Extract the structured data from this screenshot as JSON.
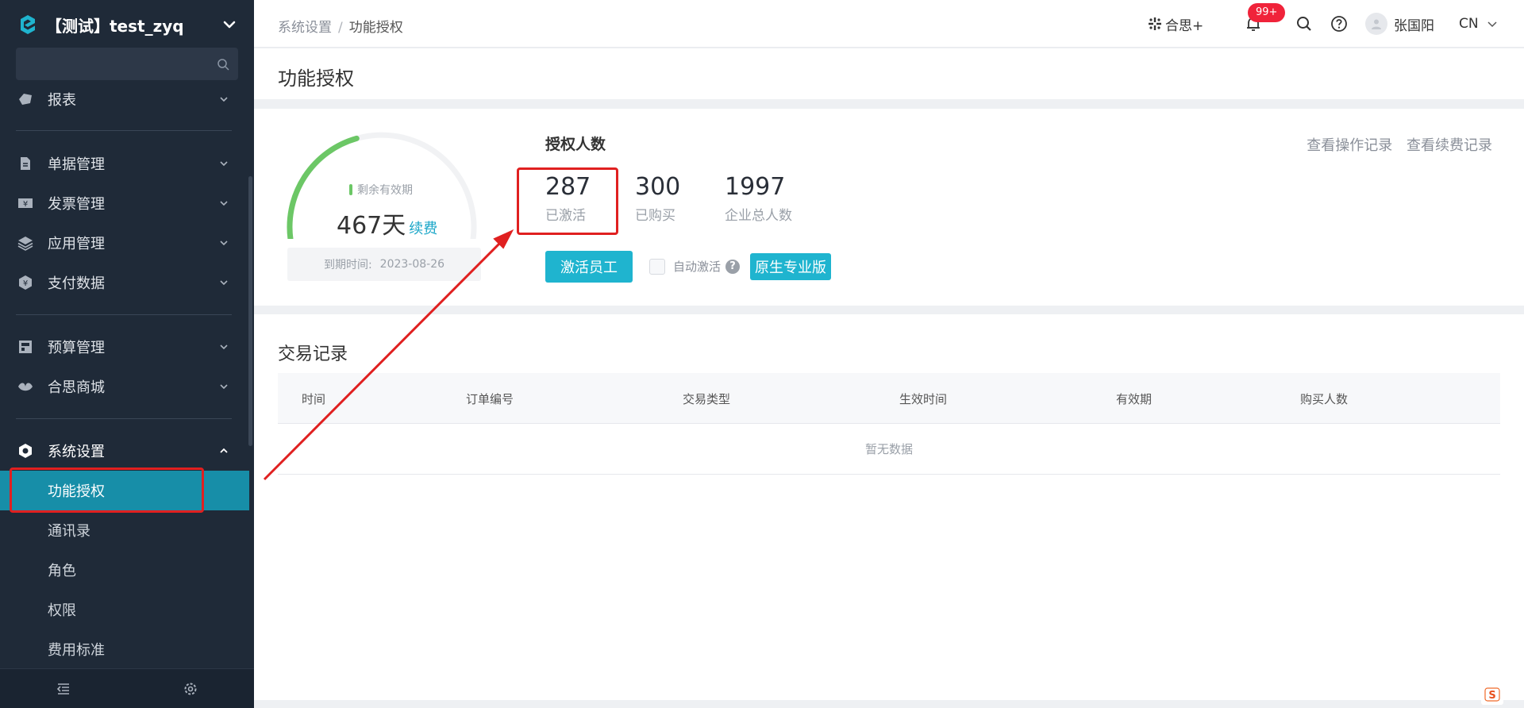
{
  "colors": {
    "sidebar_bg": "#1f2a38",
    "accent": "#1fb4cf",
    "active_menu": "#178ea8",
    "gauge_green": "#6cc766",
    "badge_red": "#f0233a",
    "annotation_red": "#e02020"
  },
  "sidebar": {
    "tenant": "【测试】test_zyq",
    "search_placeholder": "",
    "items": [
      {
        "label": "报表",
        "icon": "report-icon"
      },
      {
        "label": "单据管理",
        "icon": "document-icon"
      },
      {
        "label": "发票管理",
        "icon": "invoice-icon"
      },
      {
        "label": "应用管理",
        "icon": "layers-icon"
      },
      {
        "label": "支付数据",
        "icon": "payment-icon"
      },
      {
        "label": "预算管理",
        "icon": "budget-icon"
      },
      {
        "label": "合思商城",
        "icon": "mall-icon"
      },
      {
        "label": "系统设置",
        "icon": "settings-hex-icon"
      }
    ],
    "sub_items": [
      {
        "label": "功能授权",
        "active": true
      },
      {
        "label": "通讯录",
        "active": false
      },
      {
        "label": "角色",
        "active": false
      },
      {
        "label": "权限",
        "active": false
      },
      {
        "label": "费用标准",
        "active": false
      }
    ]
  },
  "header": {
    "breadcrumb": [
      "系统设置",
      "功能授权"
    ],
    "app_link": "合思+",
    "notification_badge": "99+",
    "user_name": "张国阳",
    "language": "CN"
  },
  "page": {
    "title": "功能授权"
  },
  "license": {
    "gauge_fraction": 0.42,
    "remaining_label": "剩余有效期",
    "remaining_days": "467天",
    "renew_label": "续费",
    "expire_label": "到期时间:",
    "expire_date": "2023-08-26",
    "title": "授权人数",
    "stats": [
      {
        "value": "287",
        "label": "已激活"
      },
      {
        "value": "300",
        "label": "已购买"
      },
      {
        "value": "1997",
        "label": "企业总人数"
      }
    ],
    "link_operation_log": "查看操作记录",
    "link_renewal_log": "查看续费记录",
    "activate_button": "激活员工",
    "auto_activate_label": "自动激活",
    "edition_badge": "原生专业版"
  },
  "transactions": {
    "title": "交易记录",
    "columns": [
      "时间",
      "订单编号",
      "交易类型",
      "生效时间",
      "有效期",
      "购买人数"
    ],
    "empty_text": "暂无数据"
  }
}
